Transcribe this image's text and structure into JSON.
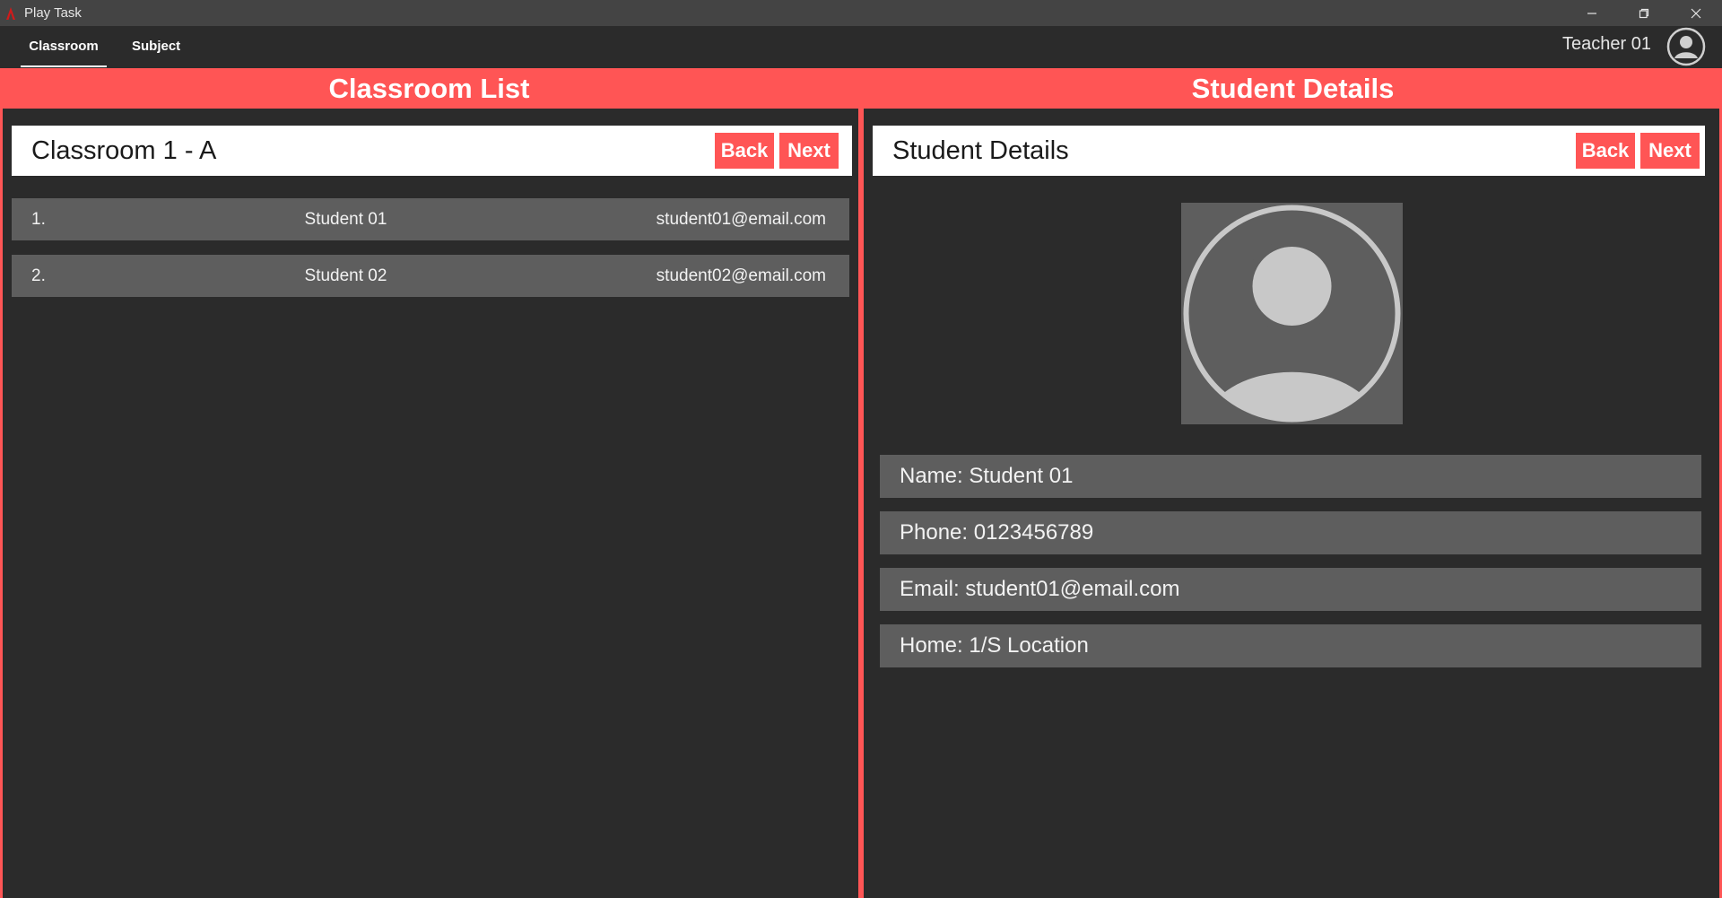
{
  "window": {
    "title": "Play Task"
  },
  "nav": {
    "tabs": [
      {
        "label": "Classroom"
      },
      {
        "label": "Subject"
      }
    ],
    "user_name": "Teacher 01"
  },
  "classroom_panel": {
    "band_title": "Classroom List",
    "header_title": "Classroom 1 - A",
    "back_label": "Back",
    "next_label": "Next",
    "students": [
      {
        "num": "1.",
        "name": "Student 01",
        "email": "student01@email.com"
      },
      {
        "num": "2.",
        "name": "Student 02",
        "email": "student02@email.com"
      }
    ]
  },
  "details_panel": {
    "band_title": "Student Details",
    "header_title": "Student Details",
    "back_label": "Back",
    "next_label": "Next",
    "fields": [
      {
        "text": "Name: Student 01"
      },
      {
        "text": "Phone: 0123456789"
      },
      {
        "text": "Email: student01@email.com"
      },
      {
        "text": "Home: 1/S Location"
      }
    ]
  },
  "colors": {
    "accent": "#ff5555",
    "background": "#2b2b2b",
    "row": "#5e5e5e",
    "titlebar": "#444444"
  },
  "icons": [
    "app-icon",
    "minimize-icon",
    "maximize-icon",
    "close-icon",
    "user-avatar-icon",
    "profile-photo-icon"
  ]
}
